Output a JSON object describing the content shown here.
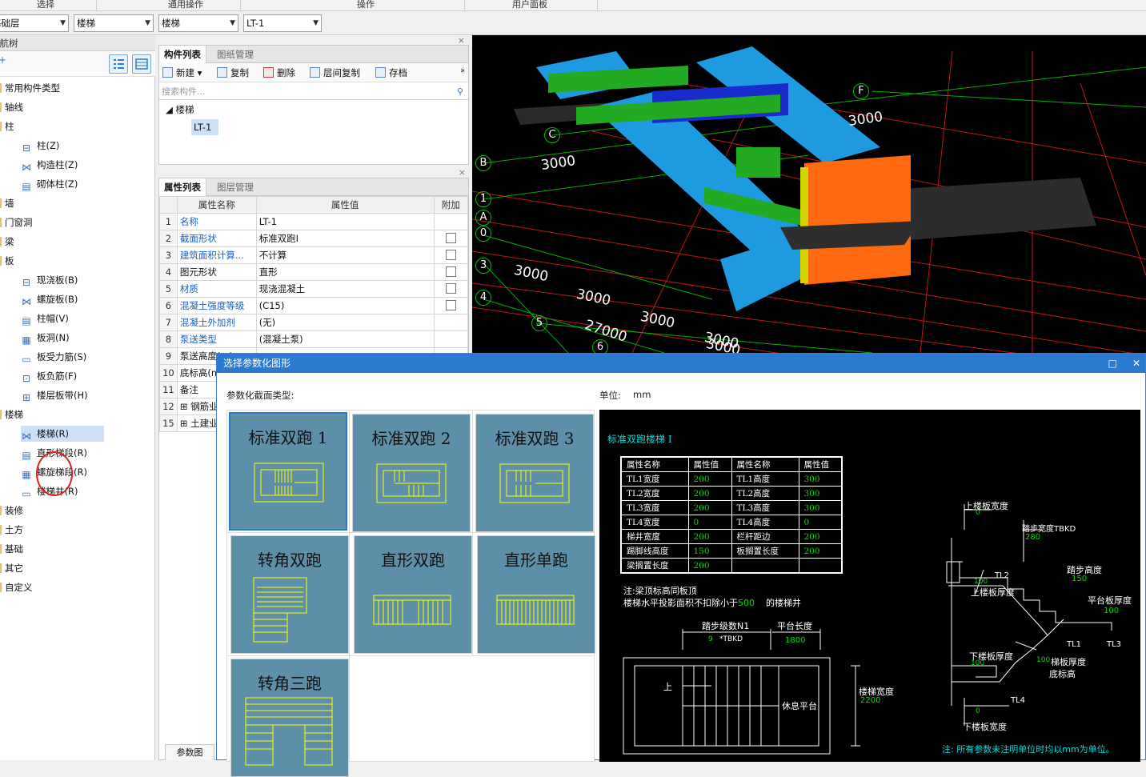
{
  "ribbon": {
    "groups": [
      "选择",
      "通用操作",
      "操作",
      "用户面板"
    ]
  },
  "selectors": {
    "floor": "基础层",
    "category": "楼梯",
    "type": "楼梯",
    "component": "LT-1"
  },
  "nav": {
    "title": "导航树",
    "items": [
      {
        "label": "常用构件类型",
        "level": 0
      },
      {
        "label": "轴线",
        "level": 0
      },
      {
        "label": "柱",
        "level": 0
      },
      {
        "label": "柱(Z)",
        "level": 1
      },
      {
        "label": "构造柱(Z)",
        "level": 1
      },
      {
        "label": "砌体柱(Z)",
        "level": 1
      },
      {
        "label": "墙",
        "level": 0
      },
      {
        "label": "门窗洞",
        "level": 0
      },
      {
        "label": "梁",
        "level": 0
      },
      {
        "label": "板",
        "level": 0
      },
      {
        "label": "现浇板(B)",
        "level": 1
      },
      {
        "label": "螺旋板(B)",
        "level": 1
      },
      {
        "label": "柱帽(V)",
        "level": 1
      },
      {
        "label": "板洞(N)",
        "level": 1
      },
      {
        "label": "板受力筋(S)",
        "level": 1
      },
      {
        "label": "板负筋(F)",
        "level": 1
      },
      {
        "label": "楼层板带(H)",
        "level": 1
      },
      {
        "label": "楼梯",
        "level": 0
      },
      {
        "label": "楼梯(R)",
        "level": 1,
        "selected": true
      },
      {
        "label": "直形梯段(R)",
        "level": 1
      },
      {
        "label": "螺旋梯段(R)",
        "level": 1
      },
      {
        "label": "楼梯井(R)",
        "level": 1
      },
      {
        "label": "装修",
        "level": 0
      },
      {
        "label": "土方",
        "level": 0
      },
      {
        "label": "基础",
        "level": 0
      },
      {
        "label": "其它",
        "level": 0
      },
      {
        "label": "自定义",
        "level": 0
      }
    ]
  },
  "component_list": {
    "tabs": [
      "构件列表",
      "图纸管理"
    ],
    "toolbar": [
      "新建",
      "复制",
      "删除",
      "层间复制",
      "存档"
    ],
    "search_placeholder": "搜索构件...",
    "tree_root": "楼梯",
    "tree_child": "LT-1"
  },
  "properties": {
    "tabs": [
      "属性列表",
      "图层管理"
    ],
    "headers": [
      "属性名称",
      "属性值",
      "附加"
    ],
    "rows": [
      {
        "no": "1",
        "name": "名称",
        "value": "LT-1",
        "blue": true,
        "check": false
      },
      {
        "no": "2",
        "name": "截面形状",
        "value": "标准双跑I",
        "blue": true,
        "check": true
      },
      {
        "no": "3",
        "name": "建筑面积计算...",
        "value": "不计算",
        "blue": true,
        "check": true
      },
      {
        "no": "4",
        "name": "图元形状",
        "value": "直形",
        "blue": false,
        "check": true
      },
      {
        "no": "5",
        "name": "材质",
        "value": "现浇混凝土",
        "blue": true,
        "check": true
      },
      {
        "no": "6",
        "name": "混凝土强度等级",
        "value": "(C15)",
        "blue": true,
        "check": true
      },
      {
        "no": "7",
        "name": "混凝土外加剂",
        "value": "(无)",
        "blue": true,
        "check": false
      },
      {
        "no": "8",
        "name": "泵送类型",
        "value": "(混凝土泵)",
        "blue": true,
        "check": false
      },
      {
        "no": "9",
        "name": "泵送高度(m)",
        "value": "",
        "blue": false,
        "check": false
      },
      {
        "no": "10",
        "name": "底标高(m)",
        "value": "",
        "blue": false,
        "check": false
      },
      {
        "no": "11",
        "name": "备注",
        "value": "",
        "blue": false,
        "check": false
      },
      {
        "no": "12",
        "name": "钢筋业务属性",
        "value": "",
        "blue": false,
        "check": false,
        "expand": true
      },
      {
        "no": "15",
        "name": "土建业务属性",
        "value": "",
        "blue": false,
        "check": false,
        "expand": true
      }
    ],
    "bottom_tab": "参数图"
  },
  "viewport": {
    "axis_labels": [
      "F",
      "C",
      "B",
      "1",
      "A",
      "0",
      "3",
      "4",
      "5",
      "6"
    ],
    "dims": [
      "3000",
      "3000",
      "3000",
      "3000",
      "3000",
      "3000",
      "27000",
      "3000"
    ]
  },
  "dialog": {
    "title": "选择参数化图形",
    "type_label": "参数化截面类型:",
    "unit_label": "单位:",
    "unit_value": "mm",
    "shapes": [
      "标准双跑 1",
      "标准双跑 2",
      "标准双跑 3",
      "转角双跑",
      "直形双跑",
      "直形单跑",
      "转角三跑"
    ],
    "preview": {
      "title": "标准双跑楼梯 I",
      "table_headers": [
        "属性名称",
        "属性值",
        "属性名称",
        "属性值"
      ],
      "table_rows": [
        [
          "TL1宽度",
          "200",
          "TL1高度",
          "300"
        ],
        [
          "TL2宽度",
          "200",
          "TL2高度",
          "300"
        ],
        [
          "TL3宽度",
          "200",
          "TL3高度",
          "300"
        ],
        [
          "TL4宽度",
          "0",
          "TL4高度",
          "0"
        ],
        [
          "梯井宽度",
          "200",
          "栏杆距边",
          "200"
        ],
        [
          "踢脚线高度",
          "150",
          "板搁置长度",
          "200"
        ],
        [
          "梁搁置长度",
          "200",
          "",
          ""
        ]
      ],
      "note1": "注:梁顶标高同板顶",
      "note2": "楼梯水平投影面积不扣除小于",
      "note2_value": "500",
      "note2_tail": "的楼梯井",
      "step_label": "踏步级数N1",
      "step_value": "9",
      "step_expr": "*TBKD",
      "platform_label": "平台长度",
      "platform_value": "1800",
      "width_label": "楼梯宽度",
      "width_value": "2200",
      "up_label": "上",
      "rest_label": "休息平台",
      "upper_slab_w": "上楼板宽度",
      "upper_slab_w_val": "0",
      "tread_w": "踏步宽度TBKD",
      "tread_w_val": "280",
      "riser_h": "踏步高度",
      "riser_h_val": "150",
      "tl2": "TL2",
      "upper_thick_val": "100",
      "upper_thick": "上楼板厚度",
      "plat_thick": "平台板厚度",
      "plat_thick_val": "100",
      "tl1": "TL1",
      "tl3": "TL3",
      "lower_thick": "下楼板厚度",
      "lower_thick_val": "100",
      "stair_thick_val": "100",
      "stair_thick": "梯板厚度",
      "bottom_elev": "底标高",
      "tl4": "TL4",
      "lower_w_val": "0",
      "lower_w": "下楼板宽度",
      "footnote": "注: 所有参数未注明单位时均以mm为单位。"
    }
  },
  "colors": {
    "accent": "#2b7ad1",
    "thumb": "#5d8fa8",
    "cad_cyan": "#00e0e0",
    "cad_green": "#00e000",
    "cad_yellow": "#ffff00"
  }
}
